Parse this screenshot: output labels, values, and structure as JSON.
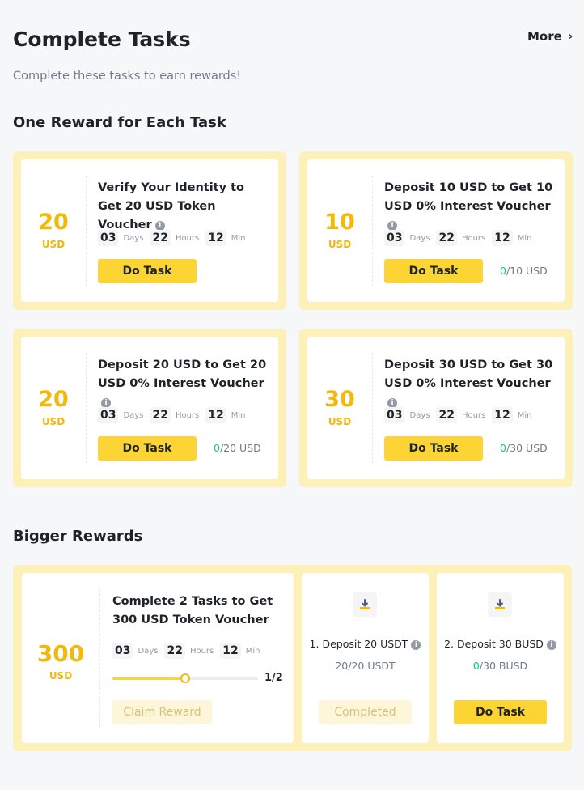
{
  "header": {
    "title": "Complete Tasks",
    "more_label": "More",
    "subtitle": "Complete these tasks to earn rewards!"
  },
  "sections": {
    "one_reward_title": "One Reward for Each Task",
    "bigger_rewards_title": "Bigger Rewards"
  },
  "countdown_labels": {
    "days": "Days",
    "hours": "Hours",
    "min": "Min"
  },
  "tasks": [
    {
      "amount": "20",
      "unit": "USD",
      "title": "Verify Your Identity to Get 20 USD Token Voucher",
      "days": "03",
      "hours": "22",
      "min": "12",
      "button": "Do Task",
      "progress_done": "",
      "progress_rest": ""
    },
    {
      "amount": "10",
      "unit": "USD",
      "title": "Deposit 10 USD to Get 10 USD 0% Interest Voucher",
      "days": "03",
      "hours": "22",
      "min": "12",
      "button": "Do Task",
      "progress_done": "0",
      "progress_rest": "/10 USD"
    },
    {
      "amount": "20",
      "unit": "USD",
      "title": "Deposit 20 USD to Get 20 USD 0% Interest Voucher",
      "days": "03",
      "hours": "22",
      "min": "12",
      "button": "Do Task",
      "progress_done": "0",
      "progress_rest": "/20 USD"
    },
    {
      "amount": "30",
      "unit": "USD",
      "title": "Deposit 30 USD to Get 30 USD 0% Interest Voucher",
      "days": "03",
      "hours": "22",
      "min": "12",
      "button": "Do Task",
      "progress_done": "0",
      "progress_rest": "/30 USD"
    }
  ],
  "bigger": {
    "amount": "300",
    "unit": "USD",
    "title": "Complete 2 Tasks to Get 300 USD Token Voucher",
    "days": "03",
    "hours": "22",
    "min": "12",
    "progress_fraction": 0.5,
    "progress_label": "1/2",
    "claim_button": "Claim Reward",
    "subtasks": [
      {
        "title": "1. Deposit 20 USDT",
        "progress_done": "",
        "progress_rest": "20/20 USDT",
        "button": "Completed",
        "icon": "deposit-icon"
      },
      {
        "title": "2. Deposit 30 BUSD",
        "progress_done": "0",
        "progress_rest": "/30 BUSD",
        "button": "Do Task",
        "icon": "deposit-icon"
      }
    ]
  },
  "colors": {
    "accent": "#fcd535",
    "amount": "#f0b90b",
    "success": "#0ecb81",
    "card_frame": "#fdf0b8"
  }
}
